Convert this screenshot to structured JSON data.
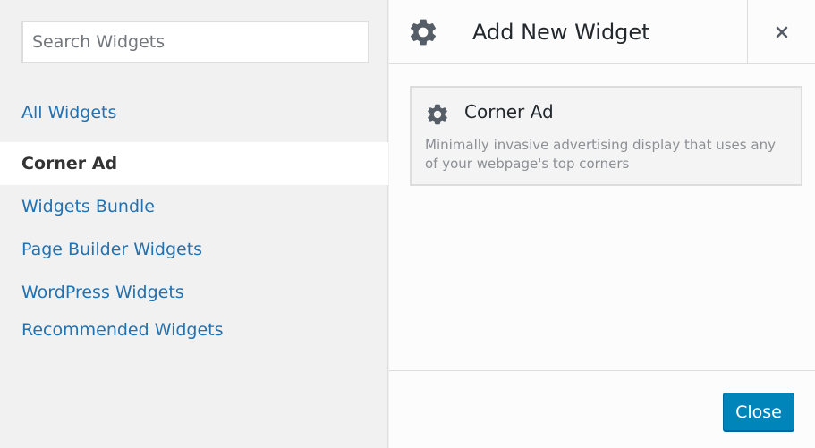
{
  "search": {
    "placeholder": "Search Widgets"
  },
  "sidebar": {
    "categories": [
      {
        "label": "All Widgets",
        "active": false
      },
      {
        "label": "Corner Ad",
        "active": true
      },
      {
        "label": "Widgets Bundle",
        "active": false
      },
      {
        "label": "Page Builder Widgets",
        "active": false
      },
      {
        "label": "WordPress Widgets",
        "active": false
      },
      {
        "label": "Recommended Widgets",
        "active": false
      }
    ]
  },
  "header": {
    "title": "Add New Widget",
    "icon": "gear-icon",
    "close_symbol": "×"
  },
  "widgets": [
    {
      "title": "Corner Ad",
      "icon": "gear-icon",
      "description": "Minimally invasive advertising display that uses any of your webpage's top corners"
    }
  ],
  "footer": {
    "close_label": "Close"
  },
  "colors": {
    "link": "#2271b1",
    "button": "#0085ba",
    "active_bg": "#ffffff",
    "sidebar_bg": "#f1f1f1"
  }
}
